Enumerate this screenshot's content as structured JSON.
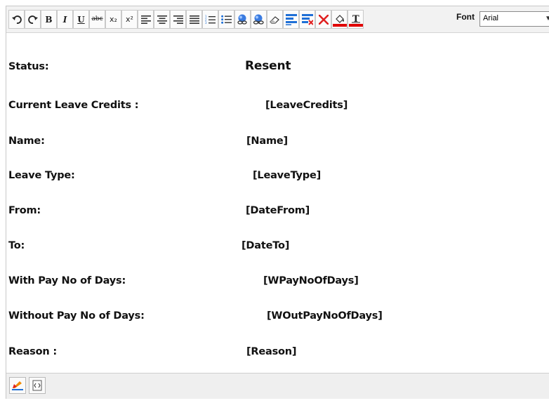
{
  "toolbar": {
    "buttons": [
      {
        "name": "undo-icon"
      },
      {
        "name": "redo-icon"
      },
      {
        "name": "bold-button",
        "glyph": "B"
      },
      {
        "name": "italic-button",
        "glyph": "I"
      },
      {
        "name": "underline-button",
        "glyph": "U"
      },
      {
        "name": "strikethrough-button",
        "glyph": "abc"
      },
      {
        "name": "subscript-button",
        "glyph": "x₂"
      },
      {
        "name": "superscript-button",
        "glyph": "x²"
      }
    ],
    "font_label": "Font",
    "font_value": "Arial"
  },
  "fields": [
    {
      "label": "Status:",
      "value": "Resent"
    },
    {
      "label": "Current Leave Credits :",
      "value": "[LeaveCredits]"
    },
    {
      "label": "Name:",
      "value": "[Name]"
    },
    {
      "label": "Leave Type:",
      "value": "[LeaveType]"
    },
    {
      "label": "From:",
      "value": "[DateFrom]"
    },
    {
      "label": "To:",
      "value": "[DateTo]"
    },
    {
      "label": "With Pay No of Days:",
      "value": "[WPayNoOfDays]"
    },
    {
      "label": "Without Pay No of Days:",
      "value": "[WOutPayNoOfDays]"
    },
    {
      "label": "Reason :",
      "value": "[Reason]"
    }
  ],
  "colors": {
    "accent_blue": "#1f6fd6",
    "delete_red": "#e02020",
    "color_bar_red": "#e00000"
  }
}
